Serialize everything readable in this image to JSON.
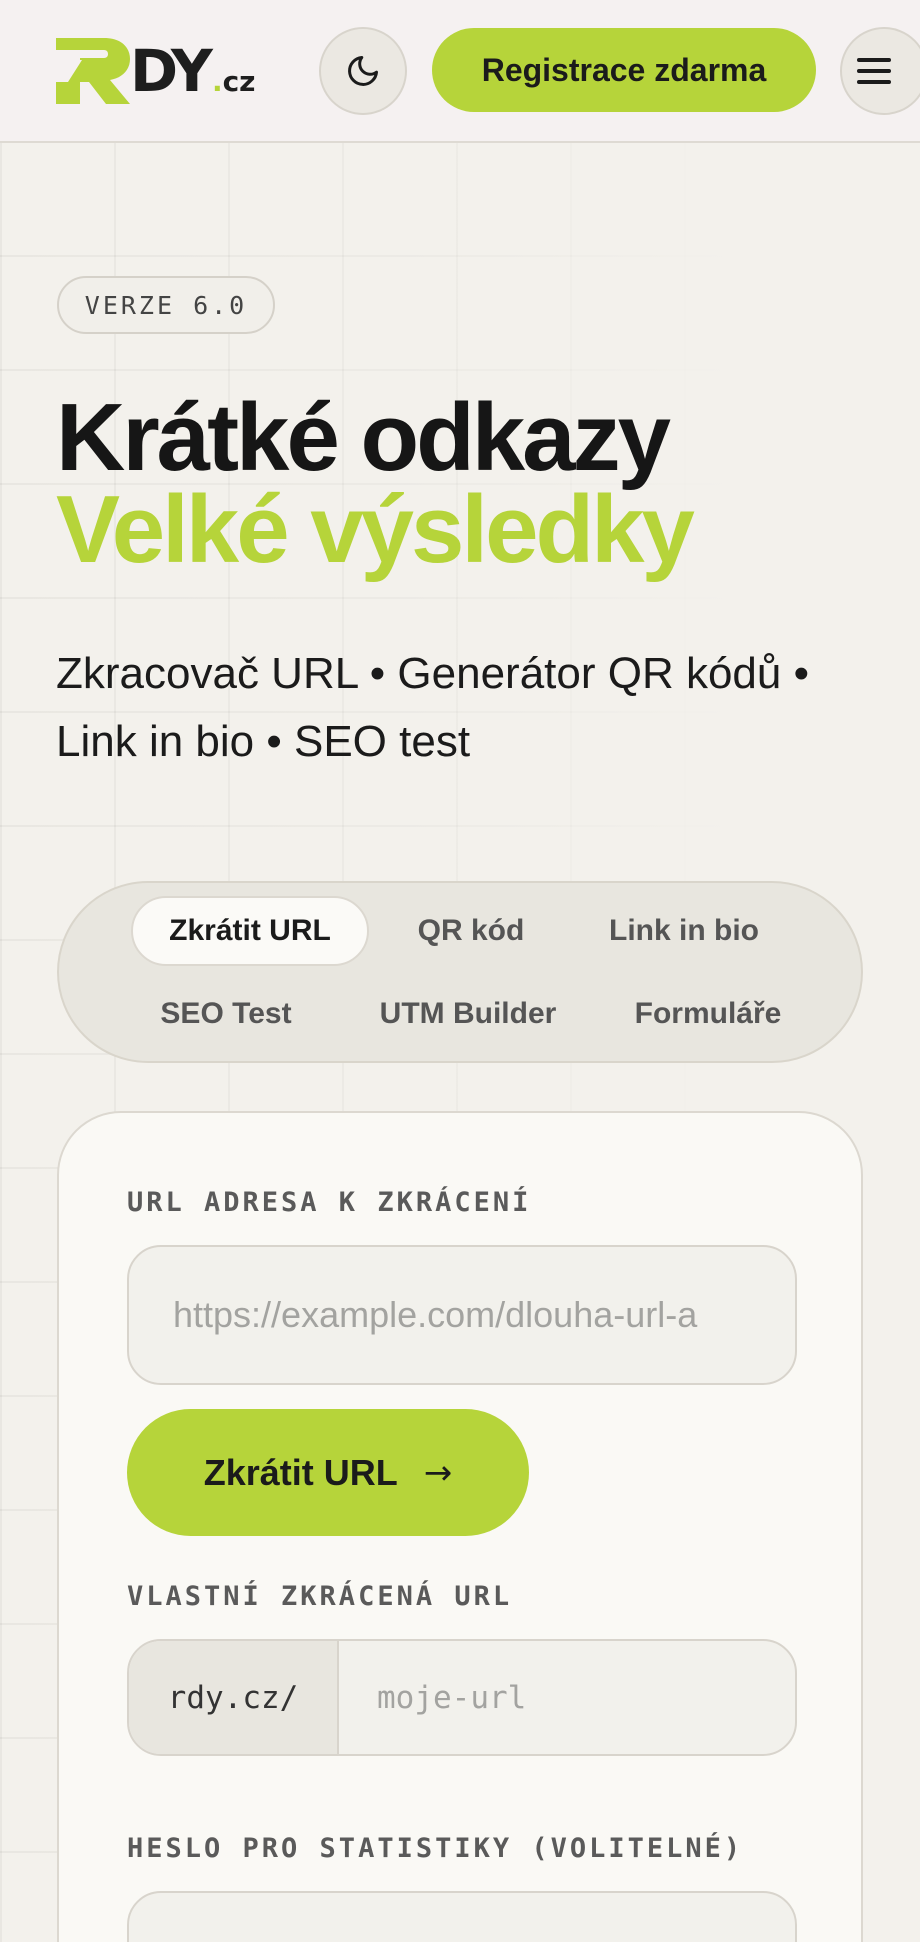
{
  "header": {
    "logo_main": "DY",
    "logo_cz": "cz",
    "logo_dot": ".",
    "register_label": "Registrace zdarma"
  },
  "hero": {
    "badge": "VERZE 6.0",
    "title_line1": "Krátké odkazy",
    "title_line2": "Velké výsledky",
    "subtitle_line1": "Zkracovač URL • Generátor QR kódů •",
    "subtitle_line2": "Link in bio • SEO test"
  },
  "tabs": [
    {
      "label": "Zkrátit URL",
      "active": true
    },
    {
      "label": "QR kód",
      "active": false
    },
    {
      "label": "Link in bio",
      "active": false
    },
    {
      "label": "SEO Test",
      "active": false
    },
    {
      "label": "UTM Builder",
      "active": false
    },
    {
      "label": "Formuláře",
      "active": false
    }
  ],
  "form": {
    "url_label": "URL ADRESA K ZKRÁCENÍ",
    "url_placeholder": "https://example.com/dlouha-url-a",
    "submit_label": "Zkrátit URL",
    "submit_arrow": "→",
    "custom_label": "VLASTNÍ ZKRÁCENÁ URL",
    "custom_prefix": "rdy.cz/",
    "custom_placeholder": "moje-url",
    "password_label": "HESLO PRO STATISTIKY (VOLITELNÉ)"
  },
  "colors": {
    "accent": "#b6d43a",
    "background": "#f3f1ec",
    "text": "#161616"
  }
}
